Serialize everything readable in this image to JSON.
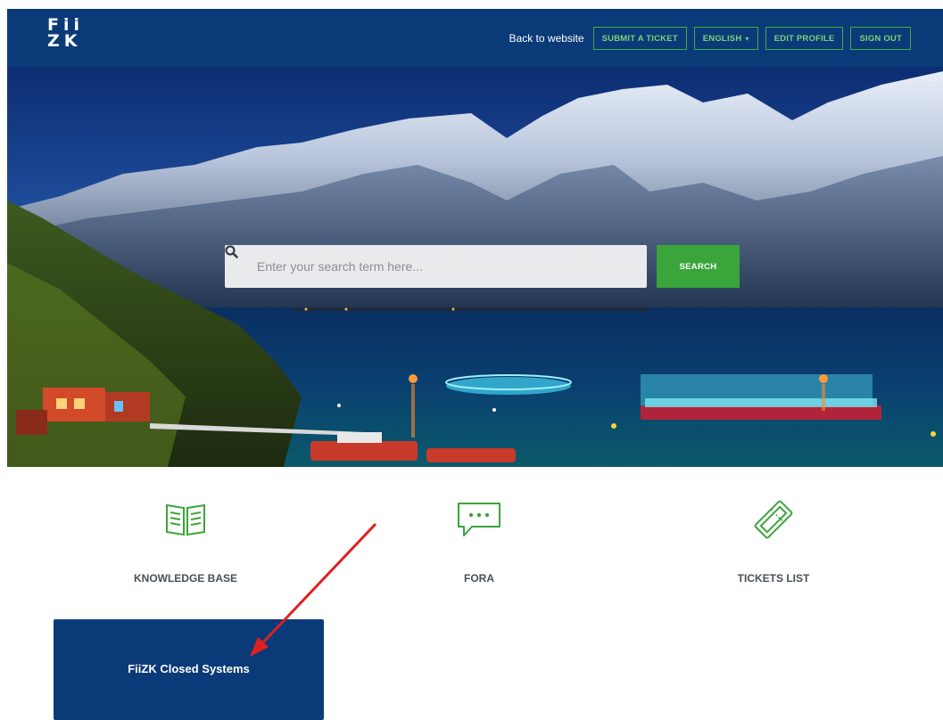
{
  "header": {
    "logo_line1": "Fii",
    "logo_line2": "ZK",
    "back_link": "Back to website",
    "buttons": {
      "submit_ticket": "SUBMIT A TICKET",
      "language": "ENGLISH",
      "edit_profile": "EDIT PROFILE",
      "sign_out": "SIGN OUT"
    }
  },
  "search": {
    "placeholder": "Enter your search term here...",
    "button_label": "SEARCH"
  },
  "categories": [
    {
      "label": "KNOWLEDGE BASE",
      "icon": "book-icon"
    },
    {
      "label": "FORA",
      "icon": "chat-bubble-icon"
    },
    {
      "label": "TICKETS LIST",
      "icon": "ticket-icon"
    }
  ],
  "featured": {
    "label": "FiiZK Closed Systems"
  },
  "colors": {
    "brand_blue": "#0b3a78",
    "accent_green": "#3aa53a",
    "annotation_red": "#e02020"
  }
}
